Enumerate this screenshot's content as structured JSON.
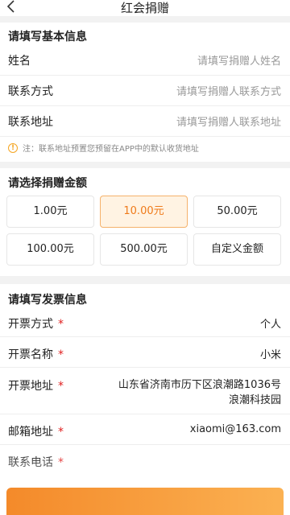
{
  "nav": {
    "title": "红会捐赠"
  },
  "basic": {
    "title": "请填写基本信息",
    "fields": [
      {
        "label": "姓名",
        "placeholder": "请填写捐赠人姓名"
      },
      {
        "label": "联系方式",
        "placeholder": "请填写捐赠人联系方式"
      },
      {
        "label": "联系地址",
        "placeholder": "请填写捐赠人联系地址"
      }
    ],
    "note_icon": "!",
    "note": "注：联系地址预置您预留在APP中的默认收货地址"
  },
  "amount": {
    "title": "请选择捐赠金额",
    "options": [
      "1.00元",
      "10.00元",
      "50.00元",
      "100.00元",
      "500.00元",
      "自定义金额"
    ],
    "selected": "10.00元"
  },
  "invoice": {
    "title": "请填写发票信息",
    "fields": [
      {
        "label": "开票方式",
        "value": "个人"
      },
      {
        "label": "开票名称",
        "value": "小米"
      },
      {
        "label": "开票地址",
        "value_line1": "山东省济南市历下区浪潮路1036号",
        "value_line2": "浪潮科技园"
      },
      {
        "label": "邮箱地址",
        "value": "xiaomi@163.com"
      },
      {
        "label": "联系电话",
        "value": ""
      }
    ],
    "required_mark": "*"
  },
  "colors": {
    "accent": "#ef7a1a",
    "selected_bg": "#fff3e3",
    "required": "#e02020"
  }
}
